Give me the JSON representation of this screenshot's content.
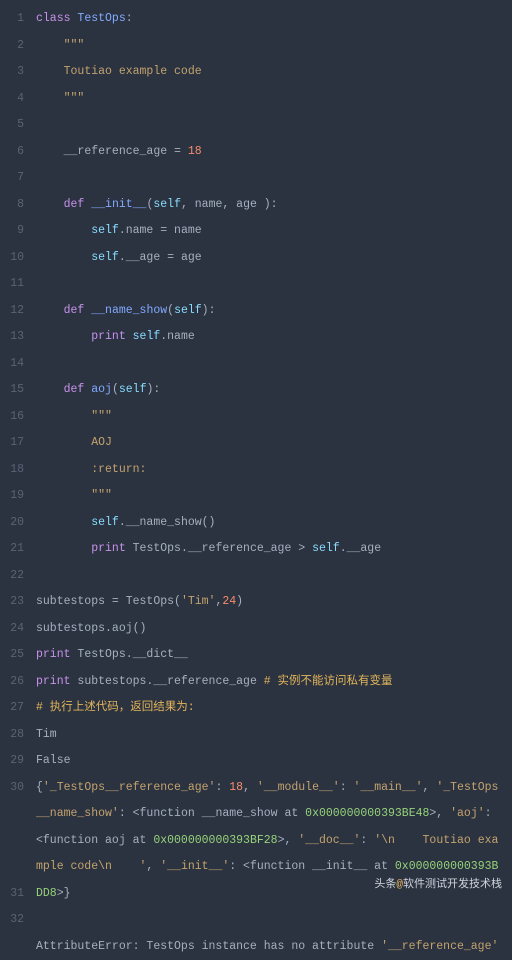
{
  "watermark": {
    "prefix": "头条",
    "at": "@",
    "name": "软件测试开发技术栈"
  },
  "lines": [
    {
      "n": 1,
      "html": "<span class='kw'>class</span> <span class='fn'>TestOps</span>:"
    },
    {
      "n": 2,
      "html": "    <span class='str'>\"\"\"</span>"
    },
    {
      "n": 3,
      "html": "    <span class='str'>Toutiao example code</span>"
    },
    {
      "n": 4,
      "html": "    <span class='str'>\"\"\"</span>"
    },
    {
      "n": 5,
      "html": ""
    },
    {
      "n": 6,
      "html": "    __reference_age = <span class='num'>18</span>"
    },
    {
      "n": 7,
      "html": ""
    },
    {
      "n": 8,
      "html": "    <span class='kw'>def</span> <span class='fn'>__init__</span>(<span class='bi'>self</span>, name, age ):"
    },
    {
      "n": 9,
      "html": "        <span class='bi'>self</span>.name = name"
    },
    {
      "n": 10,
      "html": "        <span class='bi'>self</span>.__age = age"
    },
    {
      "n": 11,
      "html": ""
    },
    {
      "n": 12,
      "html": "    <span class='kw'>def</span> <span class='fn'>__name_show</span>(<span class='bi'>self</span>):"
    },
    {
      "n": 13,
      "html": "        <span class='kw'>print</span> <span class='bi'>self</span>.name"
    },
    {
      "n": 14,
      "html": ""
    },
    {
      "n": 15,
      "html": "    <span class='kw'>def</span> <span class='fn'>aoj</span>(<span class='bi'>self</span>):"
    },
    {
      "n": 16,
      "html": "        <span class='str'>\"\"\"</span>"
    },
    {
      "n": 17,
      "html": "        <span class='str'>AOJ</span>"
    },
    {
      "n": 18,
      "html": "        <span class='str'>:return:</span>"
    },
    {
      "n": 19,
      "html": "        <span class='str'>\"\"\"</span>"
    },
    {
      "n": 20,
      "html": "        <span class='bi'>self</span>.__name_show()"
    },
    {
      "n": 21,
      "html": "        <span class='kw'>print</span> TestOps.__reference_age &gt; <span class='bi'>self</span>.__age"
    },
    {
      "n": 22,
      "html": ""
    },
    {
      "n": 23,
      "html": "subtestops = TestOps(<span class='str'>'Tim'</span>,<span class='num'>24</span>)"
    },
    {
      "n": 24,
      "html": "subtestops.aoj()"
    },
    {
      "n": 25,
      "html": "<span class='kw'>print</span> TestOps.__dict__"
    },
    {
      "n": 26,
      "html": "<span class='kw'>print</span> subtestops.__reference_age <span class='cmt'># 实例不能访问私有变量</span>"
    },
    {
      "n": 27,
      "html": "<span class='cmt2'># 执行上述代码，返回结果为:</span>"
    },
    {
      "n": 28,
      "html": "Tim"
    },
    {
      "n": 29,
      "html": "False"
    },
    {
      "n": 30,
      "html": "{<span class='str'>'_TestOps__reference_age'</span>: <span class='num'>18</span>, <span class='str'>'__module__'</span>: <span class='str'>'__main__'</span>, <span class='str'>'_TestOps__name_show'</span>: &lt;function __name_show at <span class='grn'>0x000000000393BE48</span>&gt;, <span class='str'>'aoj'</span>: &lt;function aoj at <span class='grn'>0x000000000393BF28</span>&gt;, <span class='str'>'__doc__'</span>: <span class='str'>'\\n    Toutiao example code\\n    '</span>, <span class='str'>'__init__'</span>: &lt;function __init__ at <span class='grn'>0x000000000393BDD8</span>&gt;}"
    },
    {
      "n": 31,
      "html": ""
    },
    {
      "n": 32,
      "html": "AttributeError: TestOps instance has no attribute <span class='str'>'__reference_age'</span>"
    }
  ]
}
